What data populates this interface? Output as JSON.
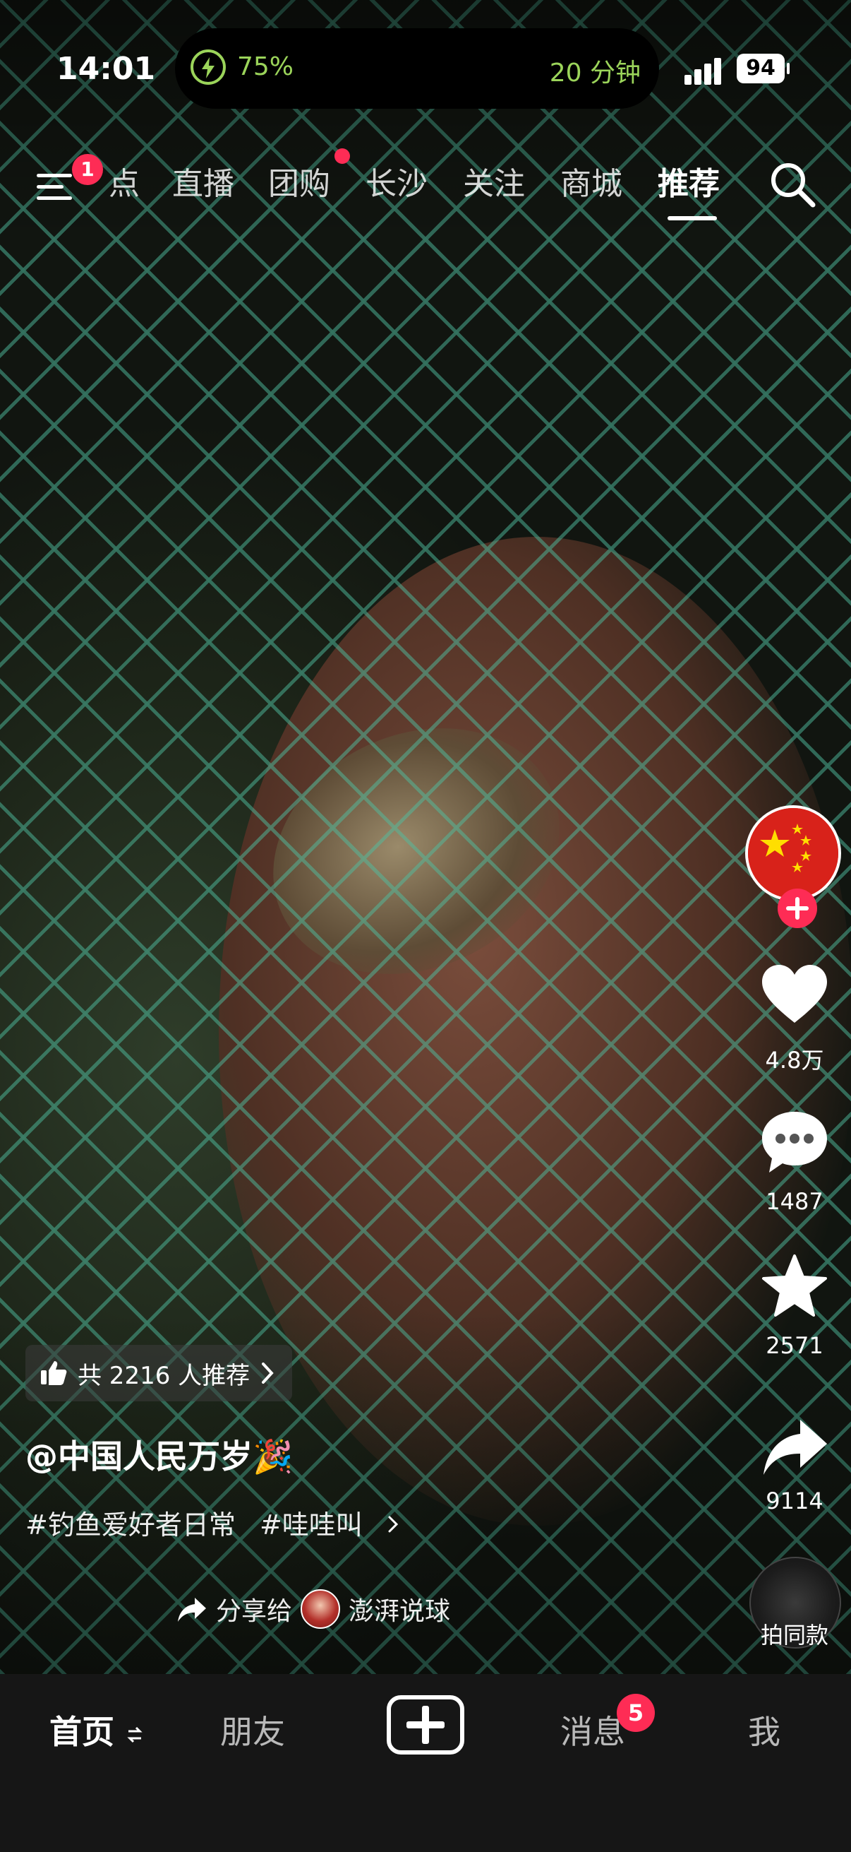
{
  "status_bar": {
    "time": "14:01",
    "battery_percent_text": "75%",
    "timer_text": "20 分钟",
    "battery_level": "94"
  },
  "top_nav": {
    "menu_badge": "1",
    "tabs": [
      {
        "label": "点",
        "active": false
      },
      {
        "label": "直播",
        "active": false
      },
      {
        "label": "团购",
        "active": false,
        "dot": true
      },
      {
        "label": "长沙",
        "active": false
      },
      {
        "label": "关注",
        "active": false
      },
      {
        "label": "商城",
        "active": false
      },
      {
        "label": "推荐",
        "active": true
      }
    ],
    "search_icon": "search-icon"
  },
  "right_rail": {
    "avatar_icon": "china-flag-avatar",
    "like_count": "4.8万",
    "comment_count": "1487",
    "favorite_count": "2571",
    "share_count": "9114",
    "disc_label": "拍同款"
  },
  "video_info": {
    "recommend_text": "共 2216 人推荐",
    "author": "@中国人民万岁🎉",
    "tags": [
      "#钓鱼爱好者日常",
      "#哇哇叫"
    ],
    "share_prefix": "分享给",
    "share_target": "澎湃说球"
  },
  "bottom_tabs": {
    "home": "首页",
    "friends": "朋友",
    "messages": "消息",
    "messages_badge": "5",
    "me": "我"
  },
  "colors": {
    "accent": "#fe2c55",
    "status_green": "#9bd45a",
    "tabbar_bg": "#161616"
  }
}
